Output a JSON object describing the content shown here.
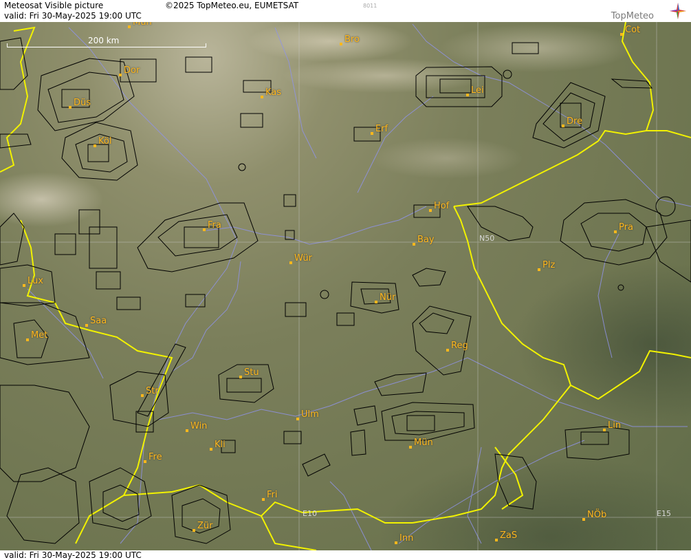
{
  "header": {
    "title": "Meteosat Visible picture",
    "copyright": "©2025 TopMeteo.eu, EUMETSAT",
    "code": "8011",
    "valid": "valid:  Fri  30-May-2025  19:00 UTC"
  },
  "logo": {
    "text": "TopMeteo",
    "icon": "topmeteo-star-icon"
  },
  "footer": {
    "valid": "valid:  Fri  30-May-2025  19:00 UTC"
  },
  "scale_bar": {
    "label": "200 km"
  },
  "grid_labels": {
    "n50": "N50",
    "e10": "E10",
    "e15": "E15"
  },
  "cities": [
    {
      "id": "mun-top",
      "name": "Mün"
    },
    {
      "id": "bro",
      "name": "Bro"
    },
    {
      "id": "cot",
      "name": "Cot"
    },
    {
      "id": "dor",
      "name": "Dor"
    },
    {
      "id": "kas",
      "name": "Kas"
    },
    {
      "id": "lei",
      "name": "Lei"
    },
    {
      "id": "dus",
      "name": "Düs"
    },
    {
      "id": "erf",
      "name": "Erf"
    },
    {
      "id": "dre",
      "name": "Dre"
    },
    {
      "id": "kol",
      "name": "Köl"
    },
    {
      "id": "hof",
      "name": "Hof"
    },
    {
      "id": "fra",
      "name": "Fra"
    },
    {
      "id": "pra",
      "name": "Pra"
    },
    {
      "id": "bay",
      "name": "Bay"
    },
    {
      "id": "wur",
      "name": "Wür"
    },
    {
      "id": "plz",
      "name": "Plz"
    },
    {
      "id": "lux",
      "name": "Lux"
    },
    {
      "id": "nur",
      "name": "Nür"
    },
    {
      "id": "saa",
      "name": "Saa"
    },
    {
      "id": "met",
      "name": "Met"
    },
    {
      "id": "reg",
      "name": "Reg"
    },
    {
      "id": "stu",
      "name": "Stu"
    },
    {
      "id": "str",
      "name": "Str"
    },
    {
      "id": "ulm",
      "name": "Ulm"
    },
    {
      "id": "win",
      "name": "Win"
    },
    {
      "id": "mun",
      "name": "Mün"
    },
    {
      "id": "lin",
      "name": "Lin"
    },
    {
      "id": "kli",
      "name": "Kli"
    },
    {
      "id": "fre",
      "name": "Fre"
    },
    {
      "id": "fri",
      "name": "Fri"
    },
    {
      "id": "nob",
      "name": "NÖb"
    },
    {
      "id": "zur",
      "name": "Zür"
    },
    {
      "id": "inn",
      "name": "Inn"
    },
    {
      "id": "zas",
      "name": "ZaS"
    }
  ],
  "colors": {
    "city": "#ffb81c",
    "border": "#f2f200",
    "river": "#8f93e8",
    "airspace": "#000000",
    "grid": "#c8c8c8"
  }
}
